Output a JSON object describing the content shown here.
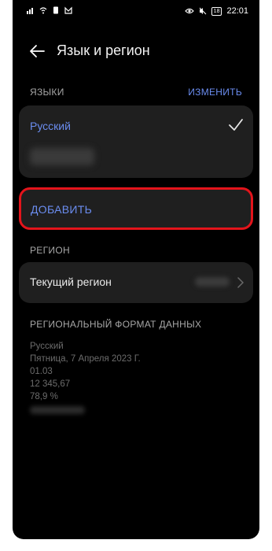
{
  "status_bar": {
    "left_icons": [
      "signal-icon",
      "wifi-icon",
      "sim-icon",
      "gmail-icon"
    ],
    "right_icons": [
      "eye-icon",
      "silent-icon",
      "battery-icon"
    ],
    "battery": "18",
    "time": "22:01"
  },
  "header": {
    "title": "Язык и регион"
  },
  "languages": {
    "section_label": "ЯЗЫКИ",
    "edit_label": "ИЗМЕНИТЬ",
    "items": [
      {
        "label": "Русский",
        "selected": true
      }
    ],
    "add_label": "ДОБАВИТЬ"
  },
  "region": {
    "section_label": "РЕГИОН",
    "current_label": "Текущий регион"
  },
  "format": {
    "section_label": "РЕГИОНАЛЬНЫЙ ФОРМАТ ДАННЫХ",
    "lines": [
      "Русский",
      "Пятница, 7 Апреля 2023 Г.",
      "01.03",
      "12 345,67",
      "78,9 %"
    ]
  },
  "colors": {
    "accent": "#6b8df0",
    "highlight": "#e3141b",
    "background": "#000000",
    "card": "#1f1f1f"
  }
}
